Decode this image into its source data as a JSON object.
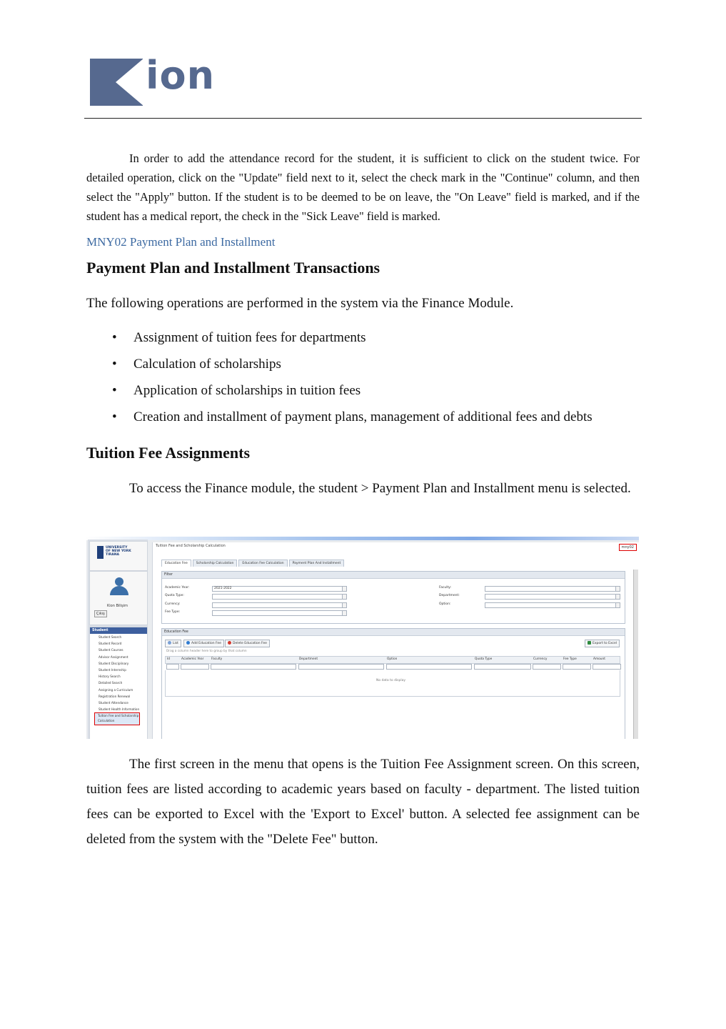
{
  "header": {
    "logo_text": "ion"
  },
  "intro_paragraph": "In order to add the attendance record for the student, it is sufficient to click on the student twice. For detailed operation, click on the \"Update\" field next to it, select the check mark in the \"Continue\" column, and then select the \"Apply\" button. If the student is to be deemed to be on leave, the \"On Leave\" field is marked, and if the student has a medical report, the check in the \"Sick Leave\" field is marked.",
  "section_label": "MNY02 Payment Plan and Installment",
  "heading_1": "Payment Plan and Installment Transactions",
  "paragraph_1": "The following operations are performed in the system via the Finance Module.",
  "bullets": [
    "Assignment of tuition fees for departments",
    "Calculation of scholarships",
    "Application of scholarships in tuition fees",
    "Creation and installment of payment plans, management of additional fees and debts"
  ],
  "heading_2": "Tuition Fee Assignments",
  "paragraph_2": "To access the Finance module, the student > Payment Plan and Installment menu is selected.",
  "screenshot": {
    "university": [
      "UNIVERSITY",
      "OF NEW YORK",
      "TIRANA"
    ],
    "person_name": "Kion Bilişim",
    "logout_label": "Çıkış",
    "menu_header": "Student",
    "menu_items": [
      "Student Search",
      "Student Record",
      "Student Courses",
      "Advisor Assignment",
      "Student Disciplinary",
      "Student Internship",
      "History Search",
      "Detailed Search",
      "Assigning a Curriculum",
      "Registration Renewal",
      "Student Attendance",
      "Student Health Information"
    ],
    "menu_selected": "Tuition Fee and Scholarship Calculation",
    "window_title": "Tuition Fee and Scholarship Calculation",
    "screen_code": "mny02",
    "tabs": [
      "Education Fee",
      "Scholarship Calculation",
      "Education Fee Calculation",
      "Payment Plan And Installment"
    ],
    "filter_title": "Filter",
    "filter_left": [
      "Academic Year:",
      "Quota Type:",
      "Currency:",
      "Fee Type:"
    ],
    "academic_year_value": "2021-2022",
    "filter_right": [
      "Faculty:",
      "Department:",
      "Option:"
    ],
    "fee_panel_title": "Education Fee",
    "btn_list": "List",
    "btn_add": "Add Education Fee",
    "btn_delete": "Delete Education Fee",
    "btn_export": "Export to Excel",
    "group_hint": "Drag a column header here to group by that column",
    "columns": [
      "Id",
      "Academic Year",
      "Faculty",
      "Department",
      "Option",
      "Quota Type",
      "Currency",
      "Fee Type",
      "Amount"
    ],
    "no_data": "No data to display"
  },
  "paragraph_3": "The first screen in the menu that opens is the Tuition Fee Assignment screen. On this screen, tuition fees are listed according to academic years based on faculty - department. The listed tuition fees can be exported to Excel with the 'Export to Excel' button. A selected fee assignment can be deleted from the system with the \"Delete Fee\" button."
}
